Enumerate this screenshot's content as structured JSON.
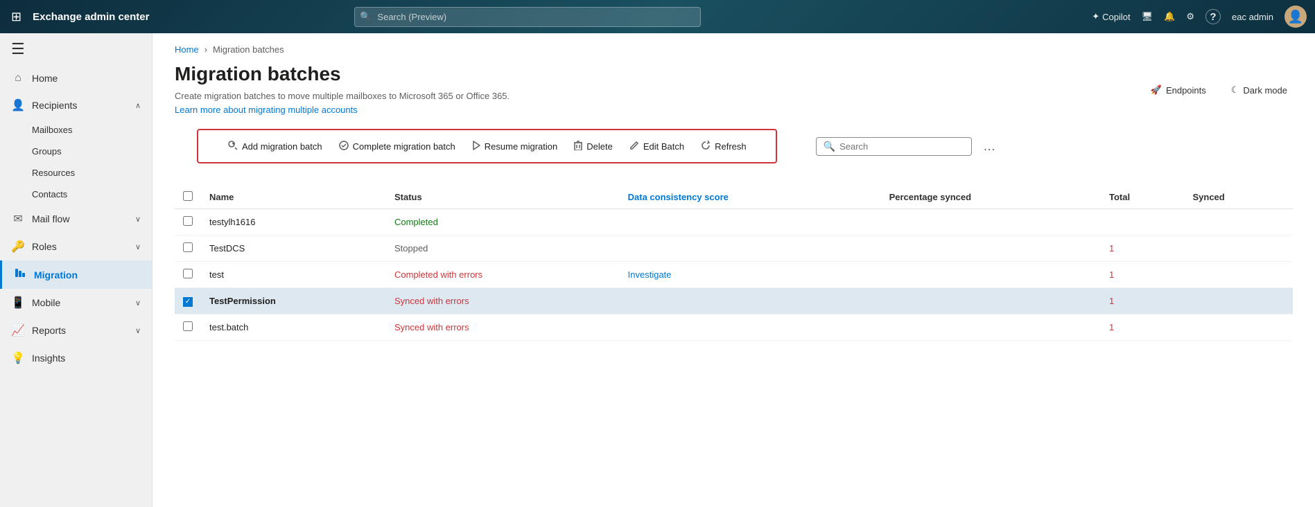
{
  "topbar": {
    "title": "Exchange admin center",
    "search_placeholder": "Search (Preview)",
    "copilot_label": "Copilot",
    "user_label": "eac admin",
    "icons": {
      "grid": "⊞",
      "search": "🔍",
      "copilot": "✦",
      "monitor": "🖥",
      "bell": "🔔",
      "gear": "⚙",
      "question": "?",
      "user": "👤"
    }
  },
  "sidebar": {
    "collapse_icon": "☰",
    "items": [
      {
        "id": "home",
        "label": "Home",
        "icon": "⌂",
        "has_children": false
      },
      {
        "id": "recipients",
        "label": "Recipients",
        "icon": "👤",
        "has_children": true,
        "expanded": true
      },
      {
        "id": "mailboxes",
        "label": "Mailboxes",
        "sub": true
      },
      {
        "id": "groups",
        "label": "Groups",
        "sub": true
      },
      {
        "id": "resources",
        "label": "Resources",
        "sub": true
      },
      {
        "id": "contacts",
        "label": "Contacts",
        "sub": true
      },
      {
        "id": "mailflow",
        "label": "Mail flow",
        "icon": "✉",
        "has_children": true
      },
      {
        "id": "roles",
        "label": "Roles",
        "icon": "🔑",
        "has_children": true
      },
      {
        "id": "migration",
        "label": "Migration",
        "icon": "📊",
        "has_children": false,
        "active": true
      },
      {
        "id": "mobile",
        "label": "Mobile",
        "icon": "📱",
        "has_children": true
      },
      {
        "id": "reports",
        "label": "Reports",
        "icon": "📈",
        "has_children": true
      },
      {
        "id": "insights",
        "label": "Insights",
        "icon": "💡",
        "has_children": false
      }
    ]
  },
  "header": {
    "breadcrumb_home": "Home",
    "breadcrumb_current": "Migration batches",
    "endpoints_label": "Endpoints",
    "dark_mode_label": "Dark mode",
    "page_title": "Migration batches",
    "page_desc": "Create migration batches to move multiple mailboxes to Microsoft 365 or Office 365.",
    "learn_more_label": "Learn more about migrating multiple accounts"
  },
  "toolbar": {
    "add_label": "Add migration batch",
    "complete_label": "Complete migration batch",
    "resume_label": "Resume migration",
    "delete_label": "Delete",
    "edit_label": "Edit Batch",
    "refresh_label": "Refresh",
    "search_placeholder": "Search",
    "more_icon": "…"
  },
  "table": {
    "columns": [
      "Name",
      "Status",
      "Data consistency score",
      "Percentage synced",
      "Total",
      "Synced"
    ],
    "rows": [
      {
        "id": 1,
        "name": "testylh1616",
        "status": "Completed",
        "status_type": "completed",
        "data_score": "",
        "pct_synced": "",
        "total": "",
        "synced": "",
        "selected": false
      },
      {
        "id": 2,
        "name": "TestDCS",
        "status": "Stopped",
        "status_type": "stopped",
        "data_score": "",
        "pct_synced": "",
        "total": "1",
        "synced": "",
        "selected": false
      },
      {
        "id": 3,
        "name": "test",
        "status": "Completed with errors",
        "status_type": "errors",
        "data_score": "Investigate",
        "pct_synced": "",
        "total": "1",
        "synced": "",
        "selected": false
      },
      {
        "id": 4,
        "name": "TestPermission",
        "status": "Synced with errors",
        "status_type": "synced-errors",
        "data_score": "",
        "pct_synced": "",
        "total": "1",
        "synced": "",
        "selected": true
      },
      {
        "id": 5,
        "name": "test.batch",
        "status": "Synced with errors",
        "status_type": "synced-errors",
        "data_score": "",
        "pct_synced": "",
        "total": "1",
        "synced": "",
        "selected": false
      }
    ]
  },
  "right_panel": {
    "synced_label": "Synced",
    "value": ""
  }
}
